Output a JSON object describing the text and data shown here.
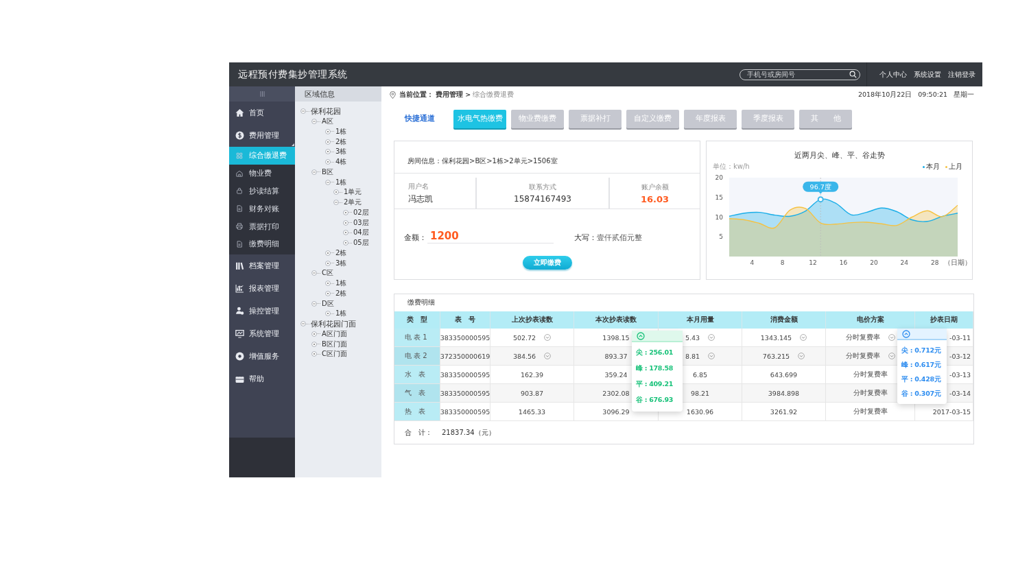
{
  "header": {
    "title": "远程预付费集抄管理系统",
    "search": {
      "placeholder": "手机号或房间号"
    },
    "links": [
      "个人中心",
      "系统设置",
      "注销登录"
    ]
  },
  "sidebar": {
    "items": [
      {
        "label": "首页",
        "selected": false,
        "expanded": false
      },
      {
        "label": "费用管理",
        "selected": false,
        "expanded": true,
        "children": [
          {
            "label": "综合缴退费",
            "selected": true
          },
          {
            "label": "物业费",
            "selected": false
          },
          {
            "label": "抄读结算",
            "selected": false
          },
          {
            "label": "财务对账",
            "selected": false
          },
          {
            "label": "票据打印",
            "selected": false
          },
          {
            "label": "缴费明细",
            "selected": false
          }
        ]
      },
      {
        "label": "档案管理",
        "selected": false,
        "expanded": false
      },
      {
        "label": "报表管理",
        "selected": false,
        "expanded": false
      },
      {
        "label": "操控管理",
        "selected": false,
        "expanded": false
      },
      {
        "label": "系统管理",
        "selected": false,
        "expanded": false
      },
      {
        "label": "增值服务",
        "selected": false,
        "expanded": false
      },
      {
        "label": "帮助",
        "selected": false,
        "expanded": false
      }
    ]
  },
  "area_tree": {
    "title": "区域信息",
    "nodes": [
      {
        "label": "保利花园",
        "expanded": true,
        "children": [
          {
            "label": "A区",
            "expanded": true,
            "children": [
              {
                "label": "1栋",
                "expanded": false
              },
              {
                "label": "2栋",
                "expanded": false
              },
              {
                "label": "3栋",
                "expanded": false
              },
              {
                "label": "4栋",
                "expanded": false
              }
            ]
          },
          {
            "label": "B区",
            "expanded": true,
            "children": [
              {
                "label": "1栋",
                "expanded": true,
                "children": [
                  {
                    "label": "1单元",
                    "expanded": false
                  },
                  {
                    "label": "2单元",
                    "expanded": true,
                    "children": [
                      {
                        "label": "02层",
                        "expanded": false
                      },
                      {
                        "label": "03层",
                        "expanded": false
                      },
                      {
                        "label": "04层",
                        "expanded": false
                      },
                      {
                        "label": "05层",
                        "expanded": false
                      }
                    ]
                  }
                ]
              },
              {
                "label": "2栋",
                "expanded": false
              },
              {
                "label": "3栋",
                "expanded": false
              }
            ]
          },
          {
            "label": "C区",
            "expanded": true,
            "children": [
              {
                "label": "1栋",
                "expanded": false
              },
              {
                "label": "2栋",
                "expanded": false
              }
            ]
          },
          {
            "label": "D区",
            "expanded": true,
            "children": [
              {
                "label": "1栋",
                "expanded": false
              }
            ]
          }
        ]
      },
      {
        "label": "保利花园门面",
        "expanded": true,
        "children": [
          {
            "label": "A区门面",
            "expanded": false
          },
          {
            "label": "B区门面",
            "expanded": false
          },
          {
            "label": "C区门面",
            "expanded": false
          }
        ]
      }
    ]
  },
  "breadcrumb": {
    "label": "当前位置：",
    "items": [
      "费用管理 >",
      "综合缴费退费"
    ]
  },
  "datetime": {
    "date": "2018年10月22日",
    "time": "09:50:21",
    "weekday": "星期一"
  },
  "quick_access": {
    "label": "快捷通道",
    "buttons": [
      {
        "label": "水电气热缴费",
        "selected": true
      },
      {
        "label": "物业费缴费",
        "selected": false
      },
      {
        "label": "票据补打",
        "selected": false
      },
      {
        "label": "自定义缴费",
        "selected": false
      },
      {
        "label": "年度报表",
        "selected": false
      },
      {
        "label": "季度报表",
        "selected": false
      },
      {
        "label": "其　　他",
        "selected": false
      }
    ]
  },
  "room": {
    "info": "房间信息：保利花园>B区>1栋>2单元>1506室",
    "fields": [
      {
        "label": "用户名",
        "value": "冯志凯",
        "kind": "plain"
      },
      {
        "label": "联系方式",
        "value": "15874167493",
        "kind": "plain"
      },
      {
        "label": "账户余额",
        "value": "16.03",
        "kind": "money"
      }
    ],
    "amount": {
      "label": "金额：",
      "value": "1200"
    },
    "uppercase": {
      "label": "大写：",
      "value": "壹仟贰佰元整"
    },
    "pay_button": "立即缴费"
  },
  "trend": {
    "title": "近两月尖、峰、平、谷走势",
    "unit": "单位：kw/h",
    "chart_data": {
      "type": "area",
      "xlabel": "（日期）",
      "x": [
        1,
        3,
        5,
        7,
        9,
        11,
        13,
        15,
        17,
        19,
        21,
        23,
        25,
        27,
        29,
        31
      ],
      "series": [
        {
          "name": "本月",
          "color": "#1aaee8",
          "values": [
            10.2,
            11,
            11.2,
            10.5,
            10.2,
            11.5,
            14.5,
            13.5,
            10.6,
            11.2,
            12.3,
            11.4,
            9.3,
            8.9,
            10.2,
            11
          ]
        },
        {
          "name": "上月",
          "color": "#f5c242",
          "values": [
            9.6,
            9.3,
            8.4,
            7.3,
            11.8,
            12.2,
            8.5,
            8.2,
            8.6,
            8.7,
            8.3,
            7.9,
            10,
            11.6,
            10.1,
            13
          ]
        }
      ],
      "xlim": [
        1,
        31
      ],
      "ylim": [
        0,
        20
      ],
      "xticks": [
        4,
        8,
        12,
        16,
        20,
        24,
        28
      ],
      "yticks": [
        5,
        10,
        15,
        20
      ],
      "ref_lines": [
        {
          "axis": "x",
          "value": 13
        }
      ],
      "annotations": [
        {
          "x": 13,
          "y": 14.5,
          "text": "96.7度"
        }
      ]
    }
  },
  "payments": {
    "title": "缴费明细",
    "columns": [
      "类　型",
      "表　号",
      "上次抄表读数",
      "本次抄表读数",
      "本月用量",
      "消费金额",
      "电价方案",
      "抄表日期"
    ],
    "rows": [
      {
        "cells": [
          {
            "text": "电 表 1",
            "dropdown": false
          },
          {
            "text": "383350000595",
            "dropdown": false
          },
          {
            "text": "502.72",
            "dropdown": true
          },
          {
            "text": "1398.15",
            "dropdown": false
          },
          {
            "text": "5.43",
            "dropdown": true
          },
          {
            "text": "1343.145",
            "dropdown": true
          },
          {
            "text": "分时复费率",
            "dropdown": true
          },
          {
            "text": "-03-11",
            "dropdown": false
          }
        ]
      },
      {
        "cells": [
          {
            "text": "电 表 2",
            "dropdown": false
          },
          {
            "text": "372350000619",
            "dropdown": false
          },
          {
            "text": "384.56",
            "dropdown": true
          },
          {
            "text": "893.37",
            "dropdown": false
          },
          {
            "text": "8.81",
            "dropdown": true
          },
          {
            "text": "763.215",
            "dropdown": true
          },
          {
            "text": "分时复费率",
            "dropdown": true
          },
          {
            "text": "-03-12",
            "dropdown": false
          }
        ]
      },
      {
        "cells": [
          {
            "text": "水　表",
            "dropdown": false
          },
          {
            "text": "383350000595",
            "dropdown": false
          },
          {
            "text": "162.39",
            "dropdown": false
          },
          {
            "text": "359.24",
            "dropdown": false
          },
          {
            "text": "6.85",
            "dropdown": false
          },
          {
            "text": "643.699",
            "dropdown": false
          },
          {
            "text": "分时复费率",
            "dropdown": false
          },
          {
            "text": "-03-13",
            "dropdown": false
          }
        ]
      },
      {
        "cells": [
          {
            "text": "气　表",
            "dropdown": false
          },
          {
            "text": "383350000595",
            "dropdown": false
          },
          {
            "text": "903.87",
            "dropdown": false
          },
          {
            "text": "2302.08",
            "dropdown": false
          },
          {
            "text": "98.21",
            "dropdown": false
          },
          {
            "text": "3984.898",
            "dropdown": false
          },
          {
            "text": "分时复费率",
            "dropdown": false
          },
          {
            "text": "-03-14",
            "dropdown": false
          }
        ]
      },
      {
        "cells": [
          {
            "text": "热　表",
            "dropdown": false
          },
          {
            "text": "383350000595",
            "dropdown": false
          },
          {
            "text": "1465.33",
            "dropdown": false
          },
          {
            "text": "3096.29",
            "dropdown": false
          },
          {
            "text": "1630.96",
            "dropdown": false
          },
          {
            "text": "3261.92",
            "dropdown": false
          },
          {
            "text": "分时复费率",
            "dropdown": false
          },
          {
            "text": "2017-03-15",
            "dropdown": false
          }
        ]
      }
    ],
    "popups": [
      {
        "kind": "reading",
        "items": [
          "尖 : 256.01",
          "峰 : 178.58",
          "平 : 409.21",
          "谷 : 676.93"
        ]
      },
      {
        "kind": "price",
        "items": [
          "尖 : 0.712元",
          "峰 : 0.617元",
          "平 : 0.428元",
          "谷 : 0.307元"
        ]
      }
    ],
    "total": {
      "label": "合　计：",
      "value": "21837.34（元）"
    }
  }
}
